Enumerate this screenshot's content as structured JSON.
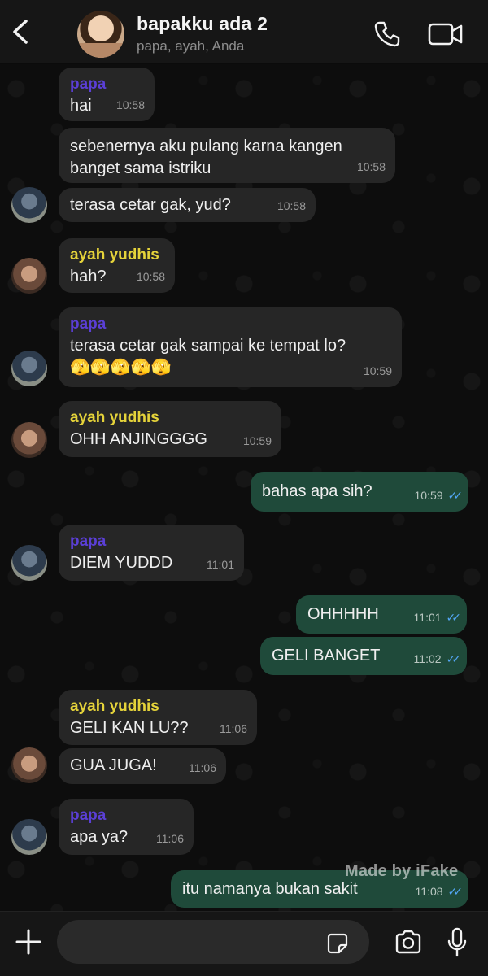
{
  "header": {
    "title": "bapakku ada 2",
    "subtitle": "papa, ayah, Anda"
  },
  "messages": [
    {
      "dir": "in",
      "sender": "papa",
      "text": "hai",
      "time": "10:58"
    },
    {
      "dir": "in",
      "sender": "",
      "text": "sebenernya aku pulang karna kangen\nbanget sama istriku",
      "time": "10:58"
    },
    {
      "dir": "in",
      "sender": "",
      "text": "terasa cetar gak, yud?",
      "time": "10:58"
    },
    {
      "dir": "in",
      "sender": "ayah yudhis",
      "text": "hah?",
      "time": "10:58"
    },
    {
      "dir": "in",
      "sender": "papa",
      "text": "terasa cetar gak sampai ke tempat lo?\n🫣🫣🫣🫣🫣",
      "time": "10:59"
    },
    {
      "dir": "in",
      "sender": "ayah yudhis",
      "text": "OHH ANJINGGGG",
      "time": "10:59"
    },
    {
      "dir": "out",
      "sender": "",
      "text": "bahas apa sih?",
      "time": "10:59",
      "ticks": "✓✓"
    },
    {
      "dir": "in",
      "sender": "papa",
      "text": "DIEM YUDDD",
      "time": "11:01"
    },
    {
      "dir": "out",
      "sender": "",
      "text": "OHHHHH",
      "time": "11:01",
      "ticks": "✓✓"
    },
    {
      "dir": "out",
      "sender": "",
      "text": "GELI BANGET",
      "time": "11:02",
      "ticks": "✓✓"
    },
    {
      "dir": "in",
      "sender": "ayah yudhis",
      "text": "GELI KAN LU??",
      "time": "11:06"
    },
    {
      "dir": "in",
      "sender": "",
      "text": "GUA JUGA!",
      "time": "11:06"
    },
    {
      "dir": "in",
      "sender": "papa",
      "text": "apa ya?",
      "time": "11:06"
    },
    {
      "dir": "out",
      "sender": "",
      "text": "itu namanya bukan sakit",
      "time": "11:08",
      "ticks": "✓✓"
    }
  ],
  "watermark": "Made by iFake",
  "input": {
    "placeholder": ""
  },
  "icons": {
    "back": "chevron-left-icon",
    "call": "phone-icon",
    "video": "video-camera-icon",
    "add": "plus-icon",
    "sticker": "sticker-icon",
    "camera": "camera-icon",
    "mic": "microphone-icon"
  },
  "colors": {
    "incoming_bubble": "#262626",
    "outgoing_bubble": "#1f4a3a",
    "papa_name": "#5b3fd6",
    "ayah_name": "#e5d33a",
    "read_ticks": "#53a6f5"
  }
}
